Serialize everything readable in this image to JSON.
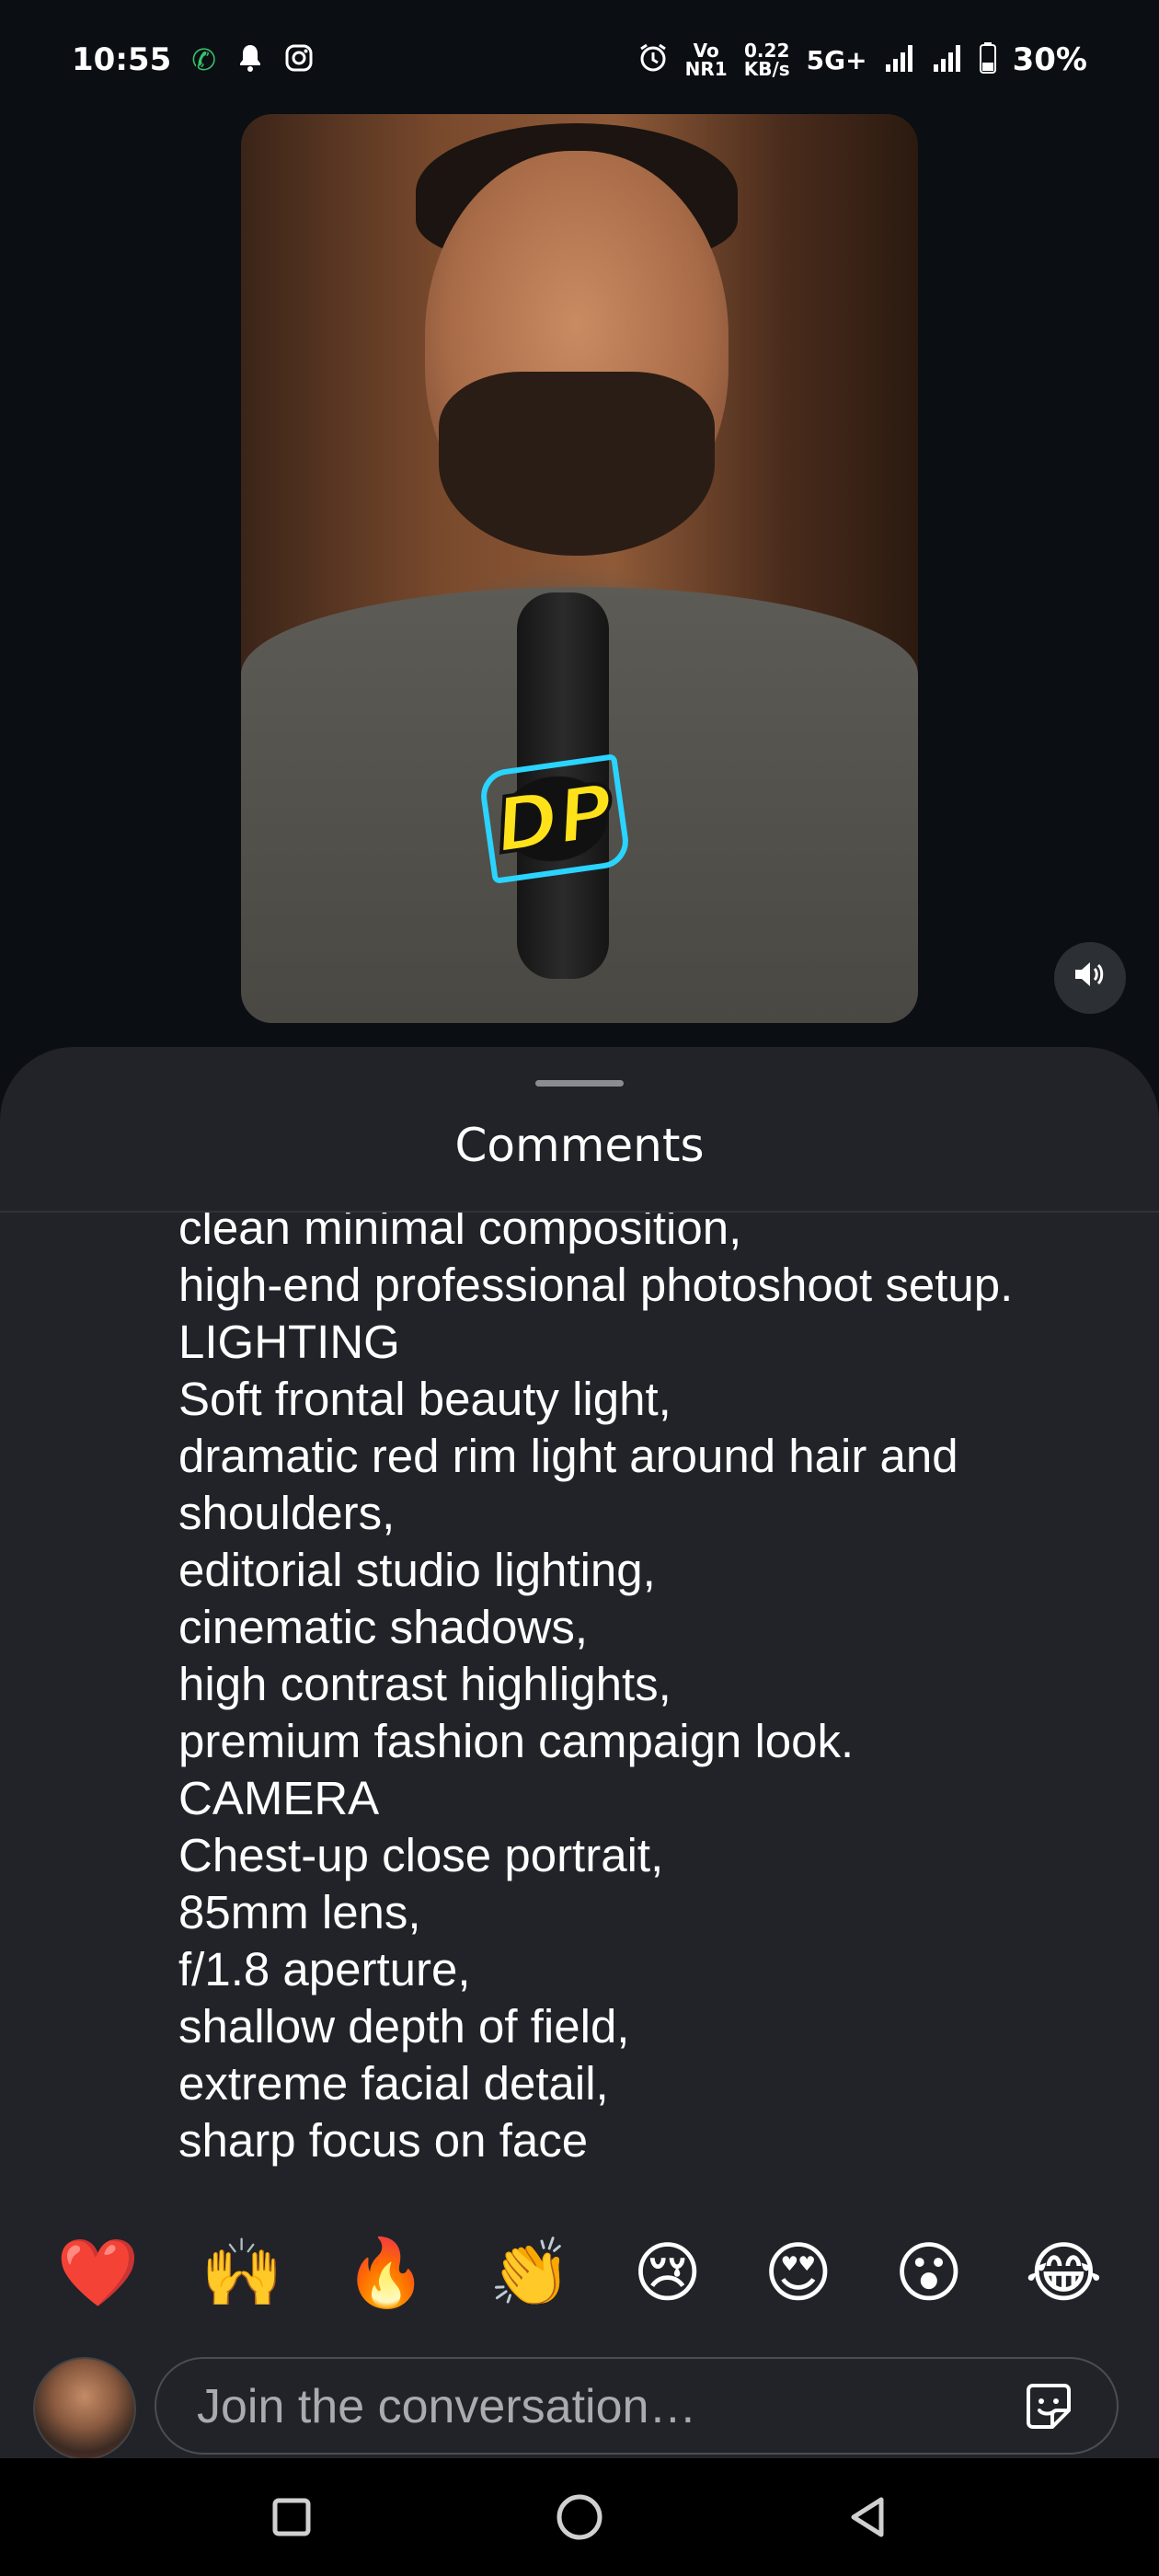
{
  "status_bar": {
    "time": "10:55",
    "volte_top": "Vo",
    "volte_bottom": "NR1",
    "speed_top": "0.22",
    "speed_bottom": "KB/s",
    "network": "5G+",
    "battery": "30%",
    "icons": [
      "call-icon",
      "notification-bell-icon",
      "instagram-icon",
      "alarm-icon",
      "signal-icon",
      "signal-icon",
      "battery-icon"
    ]
  },
  "video": {
    "logo_text": "DP",
    "volume_icon": "volume-icon"
  },
  "comments_sheet": {
    "title": "Comments",
    "comment_text": "clean minimal composition,\nhigh-end professional photoshoot setup.\nLIGHTING\nSoft frontal beauty light,\ndramatic red rim light around hair and shoulders,\neditorial studio lighting,\ncinematic shadows,\nhigh contrast highlights,\npremium fashion campaign look.\nCAMERA\nChest-up close portrait,\n85mm lens,\nf/1.8 aperture,\nshallow depth of field,\nextreme facial detail,\nsharp focus on face"
  },
  "reactions": [
    "❤️",
    "🙌",
    "🔥",
    "👏",
    "😢",
    "😍",
    "😮",
    "😂"
  ],
  "compose": {
    "placeholder": "Join the conversation…",
    "sticker_icon": "sticker-icon"
  },
  "colors": {
    "background": "#0b0e13",
    "sheet": "#212328",
    "text": "#ffffff",
    "placeholder": "#a9abaf"
  }
}
